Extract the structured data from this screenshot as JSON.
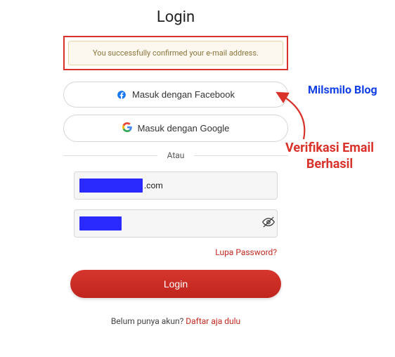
{
  "title": "Login",
  "alert": "You successfully confirmed your e-mail address.",
  "social": {
    "facebook": "Masuk dengan Facebook",
    "google": "Masuk dengan Google"
  },
  "divider": "Atau",
  "email": {
    "suffix": ".com"
  },
  "forgot": "Lupa Password?",
  "login_btn": "Login",
  "signup": {
    "prompt": "Belum punya akun? ",
    "link": "Daftar aja dulu"
  },
  "annotation": {
    "blog": "Milsmilo Blog",
    "verify_line1": "Verifikasi Email",
    "verify_line2": "Berhasil"
  }
}
